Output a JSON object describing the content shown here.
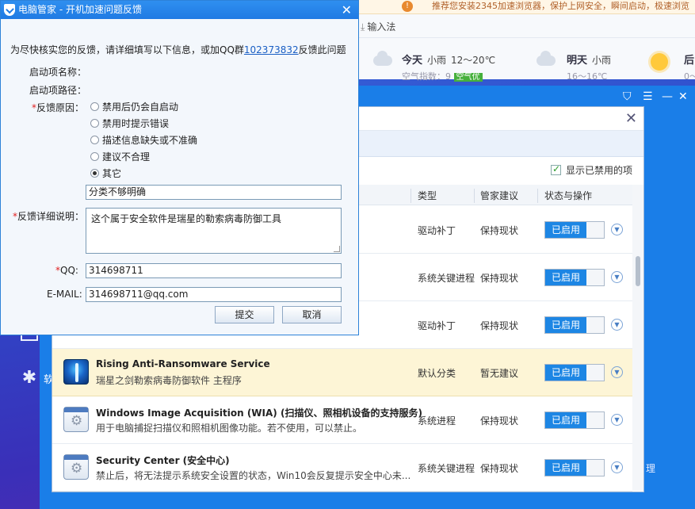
{
  "browser": {
    "notice": "推荐您安装2345加速浏览器，保护上网安全，瞬间启动，极速浏览",
    "input_method": "输入法",
    "weather": {
      "today_label": "今天",
      "today_cond": "小雨",
      "today_temp": "12～20℃",
      "aq_text": "空气指数：9",
      "aq_badge": "空气优",
      "tomorrow_label": "明天",
      "tomorrow_cond": "小雨",
      "tomorrow_temp": "16～16℃",
      "after_label": "后",
      "after_temp": "0～"
    }
  },
  "manager": {
    "side_label": "软",
    "right_text": "理"
  },
  "panel": {
    "show_disabled": "显示已禁用的项",
    "columns": {
      "type": "类型",
      "advice": "管家建议",
      "state": "状态与操作"
    },
    "rows": [
      {
        "title": "",
        "desc": "",
        "type": "驱动补丁",
        "advice": "保持现状",
        "state": "已启用",
        "icon": "none",
        "highlight": false
      },
      {
        "title": "",
        "desc": "",
        "type": "系统关键进程",
        "advice": "保持现状",
        "state": "已启用",
        "icon": "none",
        "highlight": false
      },
      {
        "title": "",
        "desc": "",
        "type": "驱动补丁",
        "advice": "保持现状",
        "state": "已启用",
        "icon": "none",
        "highlight": false
      },
      {
        "title": "Rising Anti-Ransomware Service",
        "desc": "瑞星之剑勒索病毒防御软件 主程序",
        "type": "默认分类",
        "advice": "暂无建议",
        "state": "已启用",
        "icon": "rising-shield-icon",
        "highlight": true
      },
      {
        "title": "Windows Image Acquisition (WIA) (扫描仪、照相机设备的支持服务)",
        "desc": "用于电脑捕捉扫描仪和照相机图像功能。若不使用，可以禁止。",
        "type": "系统进程",
        "advice": "保持现状",
        "state": "已启用",
        "icon": "service-gear-icon",
        "highlight": false
      },
      {
        "title": "Security Center (安全中心)",
        "desc": "禁止后，将无法提示系统安全设置的状态，Win10会反复提示安全中心未...",
        "type": "系统关键进程",
        "advice": "保持现状",
        "state": "已启用",
        "icon": "service-gear-icon",
        "highlight": false
      }
    ]
  },
  "dialog": {
    "title": "电脑管家 - 开机加速问题反馈",
    "intro_prefix": "为尽快核实您的反馈，请详细填写以下信息，或加QQ群",
    "intro_link": "102373832",
    "intro_suffix": "反馈此问题",
    "label_name": "启动项名称：",
    "label_path": "启动项路径：",
    "label_reason": "反馈原因：",
    "reasons": [
      "禁用后仍会自启动",
      "禁用时提示错误",
      "描述信息缺失或不准确",
      "建议不合理",
      "其它"
    ],
    "selected_reason": 4,
    "other_value": "分类不够明确",
    "label_detail": "反馈详细说明：",
    "detail_value": "这个属于安全软件是瑞星的勒索病毒防御工具",
    "label_qq": "QQ:",
    "qq_value": "314698711",
    "label_email": "E-MAIL:",
    "email_value": "314698711@qq.com",
    "submit_label": "提交",
    "cancel_label": "取消",
    "required_mark": "*"
  }
}
